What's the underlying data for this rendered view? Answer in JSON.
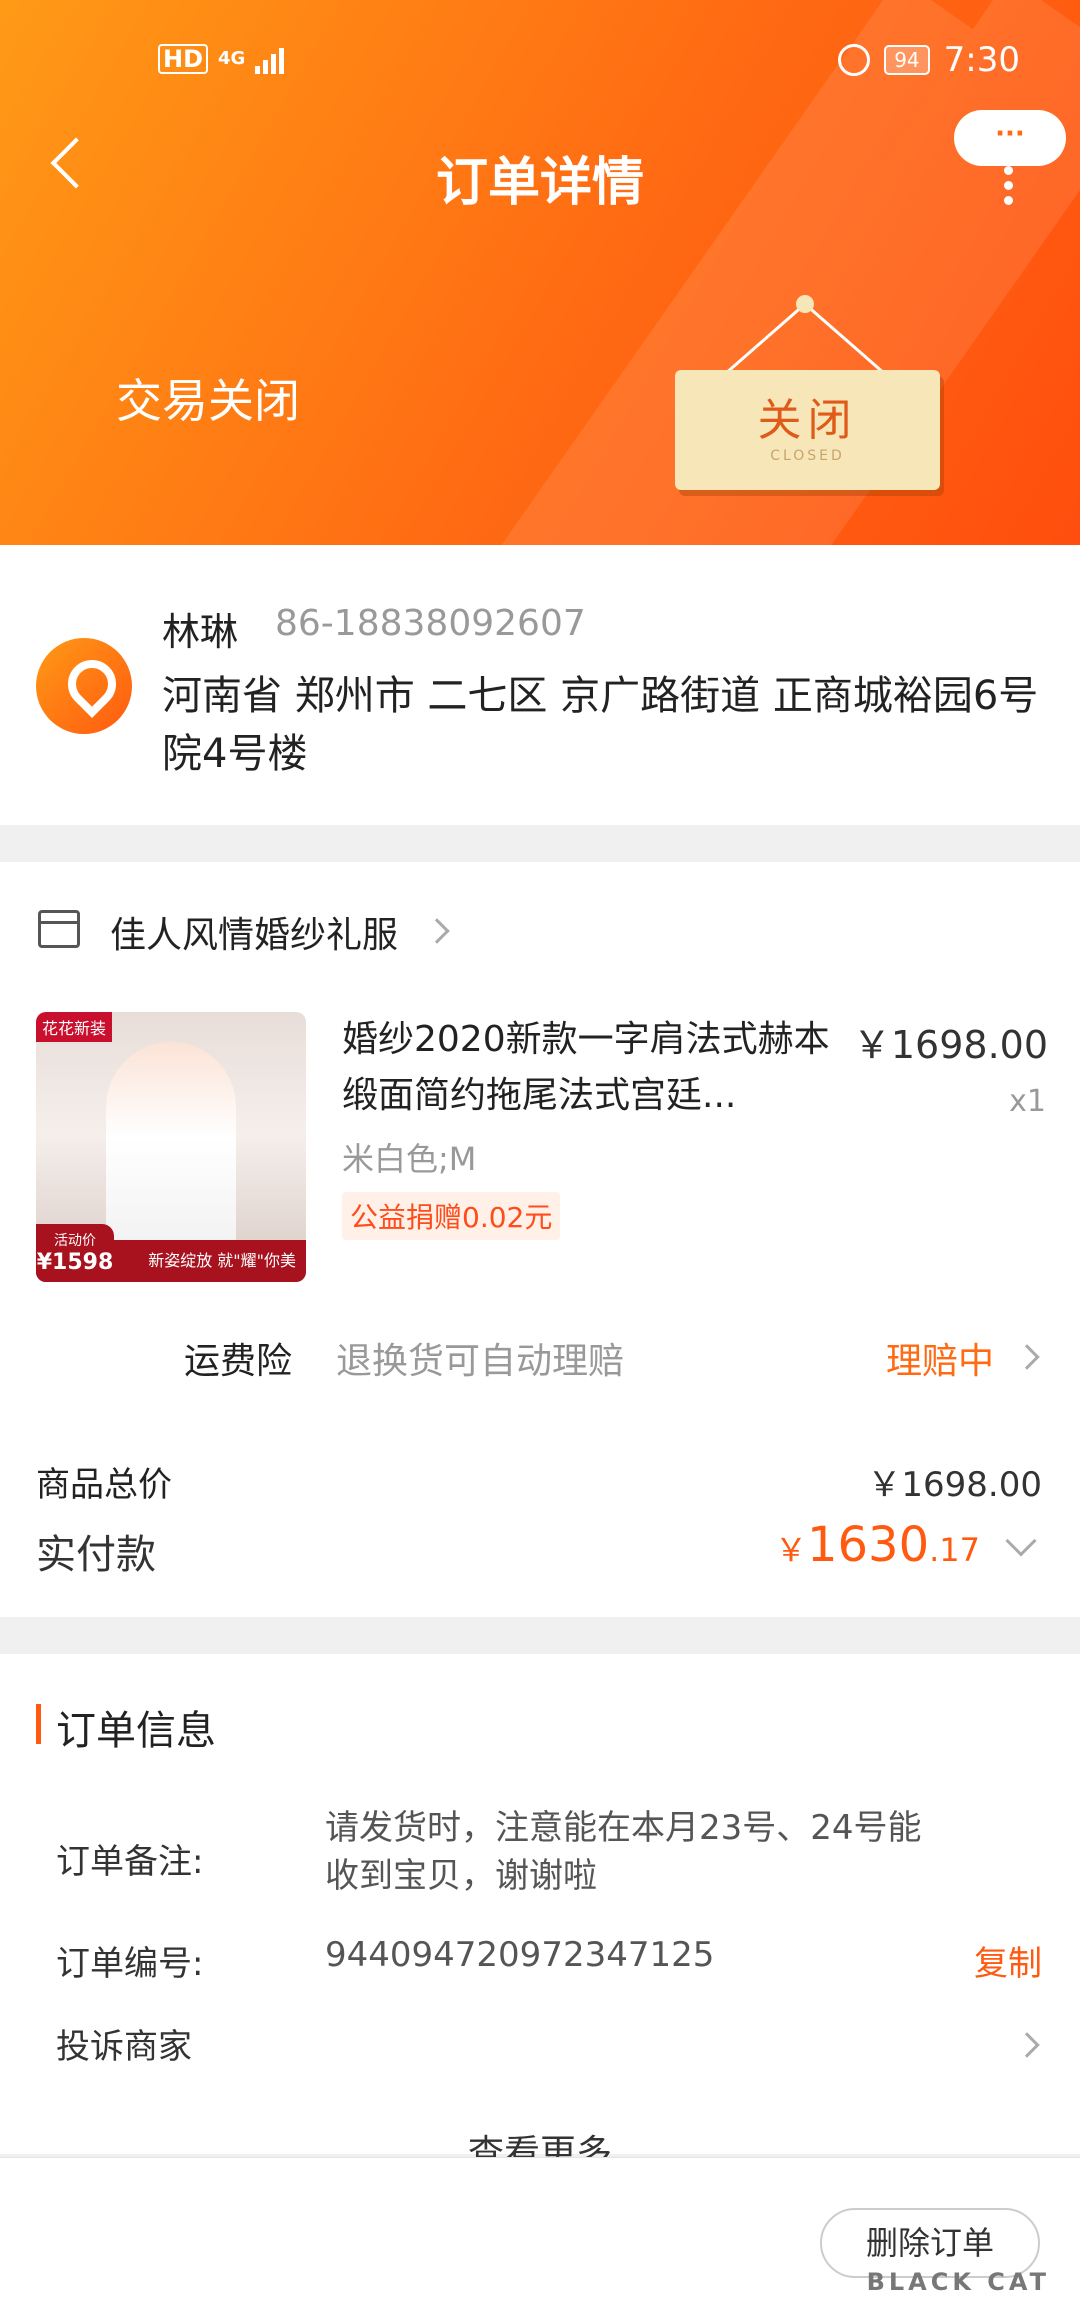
{
  "status_bar": {
    "hd": "HD",
    "network": "4G",
    "battery": "94",
    "time": "7:30"
  },
  "header": {
    "title": "订单详情",
    "more_bubble": "···",
    "order_status": "交易关闭",
    "sign_cn": "关闭",
    "sign_en": "CLOSED"
  },
  "address": {
    "name": "林琳",
    "phone": "86-18838092607",
    "full": "河南省 郑州市 二七区 京广路街道 正商城裕园6号院4号楼"
  },
  "shop": {
    "name": "佳人风情婚纱礼服"
  },
  "product": {
    "image_tag": "花花新装",
    "image_strip": "新姿绽放 就\"耀\"你美",
    "image_price_label": "活动价",
    "image_price": "¥1598",
    "title": "婚纱2020新款一字肩法式赫本缎面简约拖尾法式宫廷...",
    "price": "￥1698.00",
    "qty": "x1",
    "sku": "米白色;M",
    "charity": "公益捐赠0.02元"
  },
  "insurance": {
    "label": "运费险",
    "desc": "退换货可自动理赔",
    "status": "理赔中"
  },
  "totals": {
    "goods_label": "商品总价",
    "goods_value": "￥1698.00",
    "paid_label": "实付款",
    "paid_currency": "￥",
    "paid_integer": "1630",
    "paid_decimal": ".17"
  },
  "order_info": {
    "title": "订单信息",
    "note_label": "订单备注:",
    "note_value": "请发货时，注意能在本月23号、24号能收到宝贝，谢谢啦",
    "number_label": "订单编号:",
    "number_value": "944094720972347125",
    "copy_label": "复制",
    "complain_label": "投诉商家",
    "more_label": "查看更多"
  },
  "bottom_bar": {
    "delete_label": "删除订单",
    "watermark": "BLACK CAT"
  },
  "colors": {
    "accent": "#ff6a13",
    "price_orange": "#ff5a10"
  }
}
